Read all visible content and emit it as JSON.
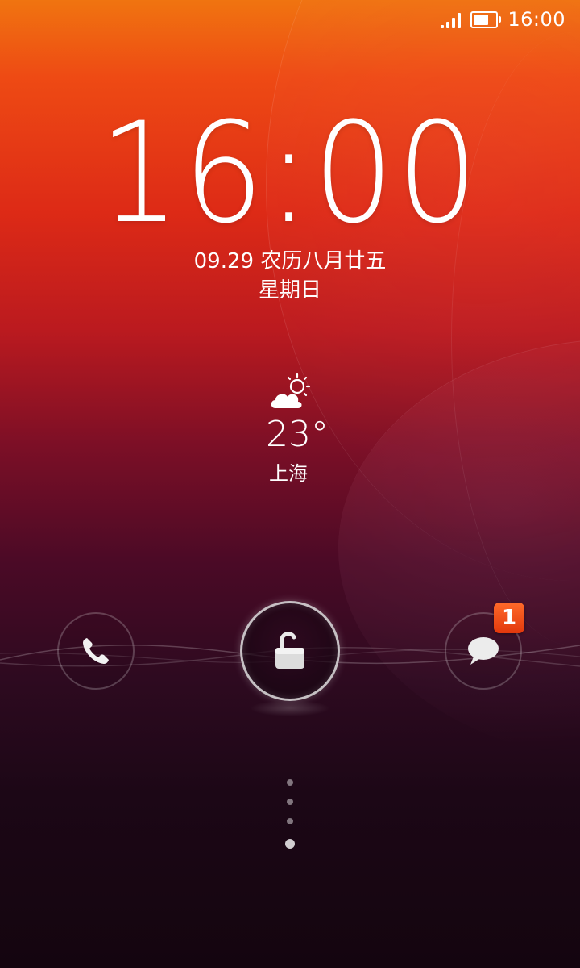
{
  "status_bar": {
    "time": "16:00",
    "signal_icon": "signal-icon",
    "battery_icon": "battery-icon",
    "battery_level": 0.8
  },
  "lockscreen": {
    "time": "16:00",
    "date": "09.29 农历八月廿五",
    "weekday": "星期日"
  },
  "weather": {
    "icon": "partly-cloudy-icon",
    "temperature": "23°",
    "city": "上海"
  },
  "shortcuts": {
    "phone": {
      "icon": "phone-icon"
    },
    "unlock": {
      "icon": "unlock-icon"
    },
    "messages": {
      "icon": "message-icon",
      "badge": "1"
    }
  },
  "pager": {
    "count": 4,
    "active_index": 3
  },
  "colors": {
    "top": "#f07410",
    "middle": "#bb1a1f",
    "bottom": "#14050f",
    "badge": "#e2380c"
  }
}
